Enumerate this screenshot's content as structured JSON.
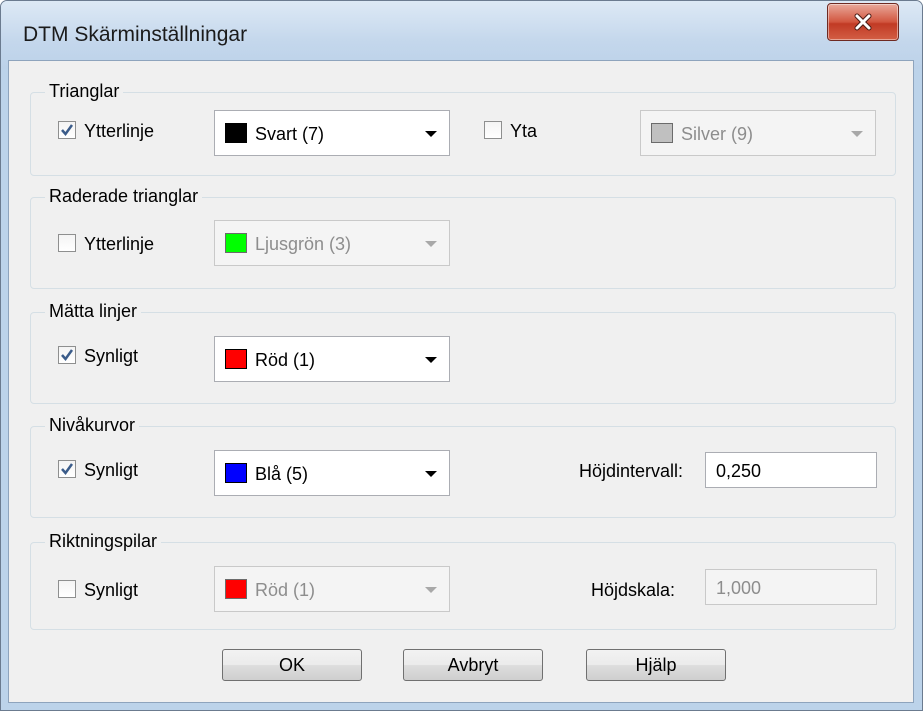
{
  "window": {
    "title": "DTM Skärminställningar",
    "close_glyph": "X"
  },
  "groups": {
    "trianglar": {
      "title": "Trianglar",
      "outline": {
        "label": "Ytterlinje",
        "checked": true,
        "color_name": "Svart (7)",
        "swatch": "#000000",
        "enabled": true
      },
      "fill": {
        "label": "Yta",
        "checked": false,
        "color_name": "Silver (9)",
        "swatch": "#c0c0c0",
        "enabled": false
      }
    },
    "raderade": {
      "title": "Raderade trianglar",
      "outline": {
        "label": "Ytterlinje",
        "checked": false,
        "color_name": "Ljusgrön (3)",
        "swatch": "#00ff00",
        "enabled": false
      }
    },
    "matta": {
      "title": "Mätta linjer",
      "visible": {
        "label": "Synligt",
        "checked": true,
        "color_name": "Röd (1)",
        "swatch": "#ff0000",
        "enabled": true
      }
    },
    "nivakurvor": {
      "title": "Nivåkurvor",
      "visible": {
        "label": "Synligt",
        "checked": true,
        "color_name": "Blå (5)",
        "swatch": "#0000ff",
        "enabled": true
      },
      "interval": {
        "label": "Höjdintervall:",
        "value": "0,250"
      }
    },
    "riktningspilar": {
      "title": "Riktningspilar",
      "visible": {
        "label": "Synligt",
        "checked": false,
        "color_name": "Röd (1)",
        "swatch": "#ff0000",
        "enabled": false
      },
      "scale": {
        "label": "Höjdskala:",
        "value": "1,000"
      }
    }
  },
  "buttons": {
    "ok": "OK",
    "cancel": "Avbryt",
    "help": "Hjälp"
  }
}
